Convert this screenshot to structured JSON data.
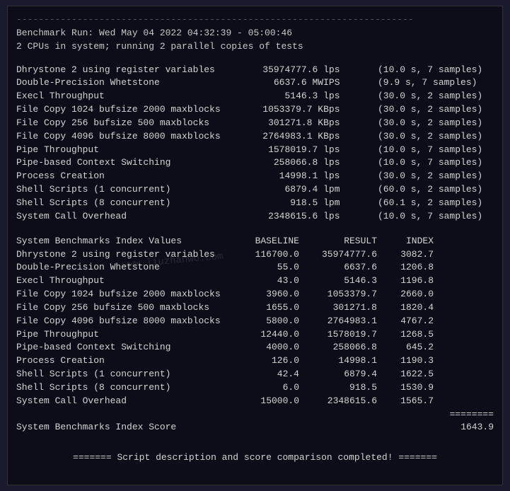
{
  "terminal": {
    "separator_top": "------------------------------------------------------------------------",
    "header1": "Benchmark Run: Wed May 04 2022 04:32:39 - 05:00:46",
    "header2": "2 CPUs in system; running 2 parallel copies of tests",
    "measurements": [
      {
        "label": "Dhrystone 2 using register variables",
        "value": "35974777.6",
        "unit": "lps",
        "info": "(10.0 s, 7 samples)"
      },
      {
        "label": "Double-Precision Whetstone",
        "value": "6637.6",
        "unit": "MWIPS",
        "info": "(9.9 s, 7 samples)"
      },
      {
        "label": "Execl Throughput",
        "value": "5146.3",
        "unit": "lps",
        "info": "(30.0 s, 2 samples)"
      },
      {
        "label": "File Copy 1024 bufsize 2000 maxblocks",
        "value": "1053379.7",
        "unit": "KBps",
        "info": "(30.0 s, 2 samples)"
      },
      {
        "label": "File Copy 256 bufsize 500 maxblocks",
        "value": "301271.8",
        "unit": "KBps",
        "info": "(30.0 s, 2 samples)"
      },
      {
        "label": "File Copy 4096 bufsize 8000 maxblocks",
        "value": "2764983.1",
        "unit": "KBps",
        "info": "(30.0 s, 2 samples)"
      },
      {
        "label": "Pipe Throughput",
        "value": "1578019.7",
        "unit": "lps",
        "info": "(10.0 s, 7 samples)"
      },
      {
        "label": "Pipe-based Context Switching",
        "value": "258066.8",
        "unit": "lps",
        "info": "(10.0 s, 7 samples)"
      },
      {
        "label": "Process Creation",
        "value": "14998.1",
        "unit": "lps",
        "info": "(30.0 s, 2 samples)"
      },
      {
        "label": "Shell Scripts (1 concurrent)",
        "value": "6879.4",
        "unit": "lpm",
        "info": "(60.0 s, 2 samples)"
      },
      {
        "label": "Shell Scripts (8 concurrent)",
        "value": "918.5",
        "unit": "lpm",
        "info": "(60.1 s, 2 samples)"
      },
      {
        "label": "System Call Overhead",
        "value": "2348615.6",
        "unit": "lps",
        "info": "(10.0 s, 7 samples)"
      }
    ],
    "table": {
      "header": {
        "label": "System Benchmarks Index Values",
        "baseline": "BASELINE",
        "result": "RESULT",
        "index": "INDEX"
      },
      "rows": [
        {
          "label": "Dhrystone 2 using register variables",
          "baseline": "116700.0",
          "result": "35974777.6",
          "index": "3082.7"
        },
        {
          "label": "Double-Precision Whetstone",
          "baseline": "55.0",
          "result": "6637.6",
          "index": "1206.8"
        },
        {
          "label": "Execl Throughput",
          "baseline": "43.0",
          "result": "5146.3",
          "index": "1196.8"
        },
        {
          "label": "File Copy 1024 bufsize 2000 maxblocks",
          "baseline": "3960.0",
          "result": "1053379.7",
          "index": "2660.0"
        },
        {
          "label": "File Copy 256 bufsize 500 maxblocks",
          "baseline": "1655.0",
          "result": "301271.8",
          "index": "1820.4"
        },
        {
          "label": "File Copy 4096 bufsize 8000 maxblocks",
          "baseline": "5800.0",
          "result": "2764983.1",
          "index": "4767.2"
        },
        {
          "label": "Pipe Throughput",
          "baseline": "12440.0",
          "result": "1578019.7",
          "index": "1268.5"
        },
        {
          "label": "Pipe-based Context Switching",
          "baseline": "4000.0",
          "result": "258066.8",
          "index": "645.2"
        },
        {
          "label": "Process Creation",
          "baseline": "126.0",
          "result": "14998.1",
          "index": "1190.3"
        },
        {
          "label": "Shell Scripts (1 concurrent)",
          "baseline": "42.4",
          "result": "6879.4",
          "index": "1622.5"
        },
        {
          "label": "Shell Scripts (8 concurrent)",
          "baseline": "6.0",
          "result": "918.5",
          "index": "1530.9"
        },
        {
          "label": "System Call Overhead",
          "baseline": "15000.0",
          "result": "2348615.6",
          "index": "1565.7"
        }
      ],
      "equals": "========",
      "score_label": "System Benchmarks Index Score",
      "score_value": "1643.9"
    },
    "footer": "======= Script description and score comparison completed! =======",
    "watermark": "www.liuzhanwo.com"
  }
}
